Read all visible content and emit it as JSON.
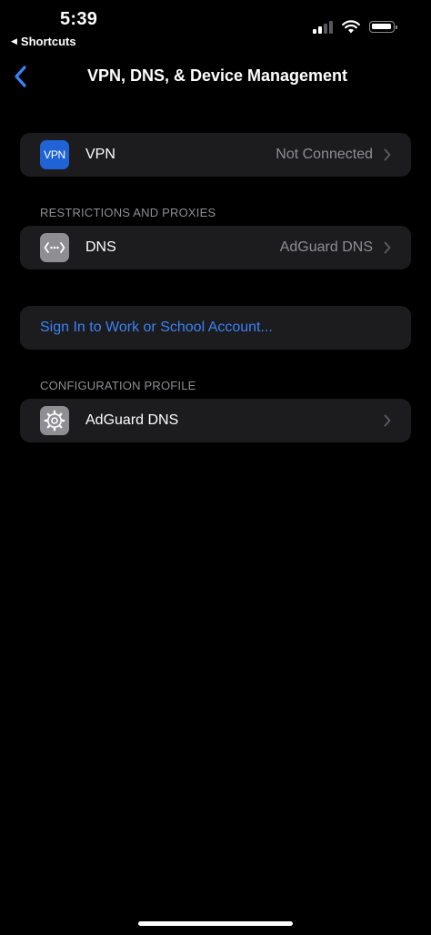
{
  "status_bar": {
    "time": "5:39",
    "back_app_label": "Shortcuts",
    "signal_icon": "cellular-signal-icon",
    "wifi_icon": "wifi-icon",
    "battery_icon": "battery-icon"
  },
  "nav": {
    "title": "VPN, DNS, & Device Management",
    "back_icon": "chevron-left-icon"
  },
  "vpn_group": {
    "label": "VPN",
    "value": "Not Connected",
    "icon_text": "VPN"
  },
  "restrictions_section": {
    "header": "RESTRICTIONS AND PROXIES",
    "dns_label": "DNS",
    "dns_value": "AdGuard DNS",
    "icon": "dns-arrows-icon"
  },
  "account_group": {
    "link_label": "Sign In to Work or School Account..."
  },
  "configuration_section": {
    "header": "CONFIGURATION PROFILE",
    "profile_label": "AdGuard DNS",
    "icon": "gear-icon"
  },
  "colors": {
    "background": "#000000",
    "group_background": "#1c1c1e",
    "secondary_text": "#8e8e93",
    "accent": "#3b82f6",
    "vpn_icon": "#1f63d6"
  }
}
